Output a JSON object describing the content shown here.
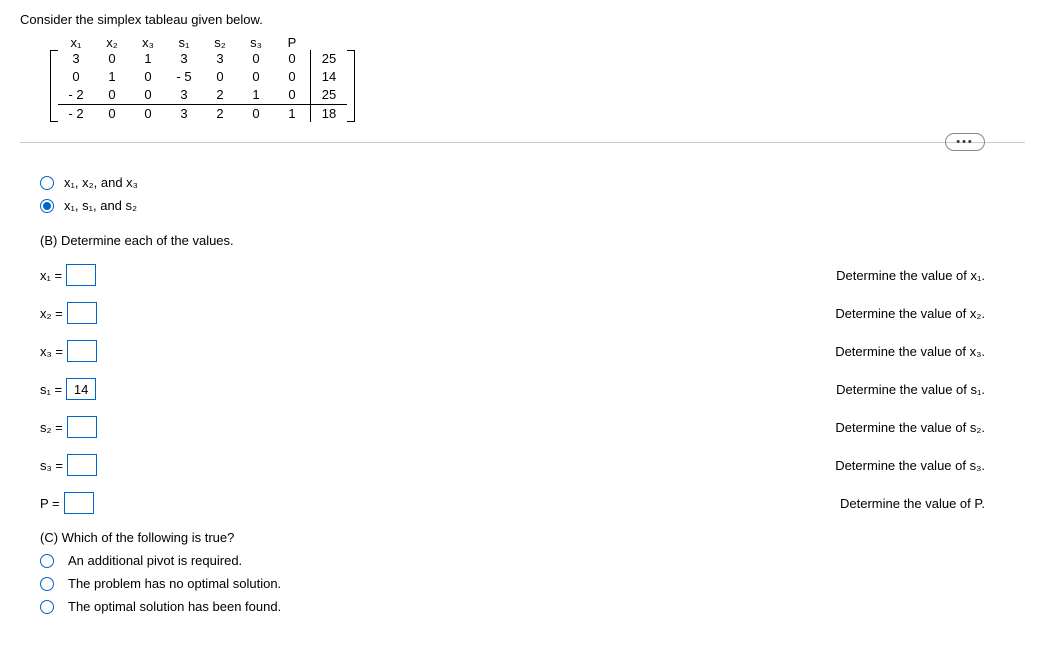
{
  "intro": "Consider the simplex tableau given below.",
  "headers": [
    "x₁",
    "x₂",
    "x₃",
    "s₁",
    "s₂",
    "s₃",
    "P",
    ""
  ],
  "rows": [
    [
      "3",
      "0",
      "1",
      "3",
      "3",
      "0",
      "0",
      "25"
    ],
    [
      "0",
      "1",
      "0",
      "- 5",
      "0",
      "0",
      "0",
      "14"
    ],
    [
      "- 2",
      "0",
      "0",
      "3",
      "2",
      "1",
      "0",
      "25"
    ],
    [
      "- 2",
      "0",
      "0",
      "3",
      "2",
      "0",
      "1",
      "18"
    ]
  ],
  "more": "•••",
  "optA": {
    "opt1": "x₁, x₂, and x₃",
    "opt2": "x₁, s₁, and s₂"
  },
  "sectionB": "(B) Determine each of the values.",
  "vals": {
    "x1": {
      "label": "x₁ =",
      "value": "",
      "hint": "Determine the value of x₁."
    },
    "x2": {
      "label": "x₂ =",
      "value": "",
      "hint": "Determine the value of x₂."
    },
    "x3": {
      "label": "x₃ =",
      "value": "",
      "hint": "Determine the value of x₃."
    },
    "s1": {
      "label": "s₁ =",
      "value": "14",
      "hint": "Determine the value of s₁."
    },
    "s2": {
      "label": "s₂ =",
      "value": "",
      "hint": "Determine the value of s₂."
    },
    "s3": {
      "label": "s₃ =",
      "value": "",
      "hint": "Determine the value of s₃."
    },
    "p": {
      "label": "P =",
      "value": "",
      "hint": "Determine the value of P."
    }
  },
  "sectionC": "(C) Which of the following is true?",
  "optC": {
    "c1": "An additional pivot is required.",
    "c2": "The problem has no optimal solution.",
    "c3": "The optimal solution has been found."
  }
}
